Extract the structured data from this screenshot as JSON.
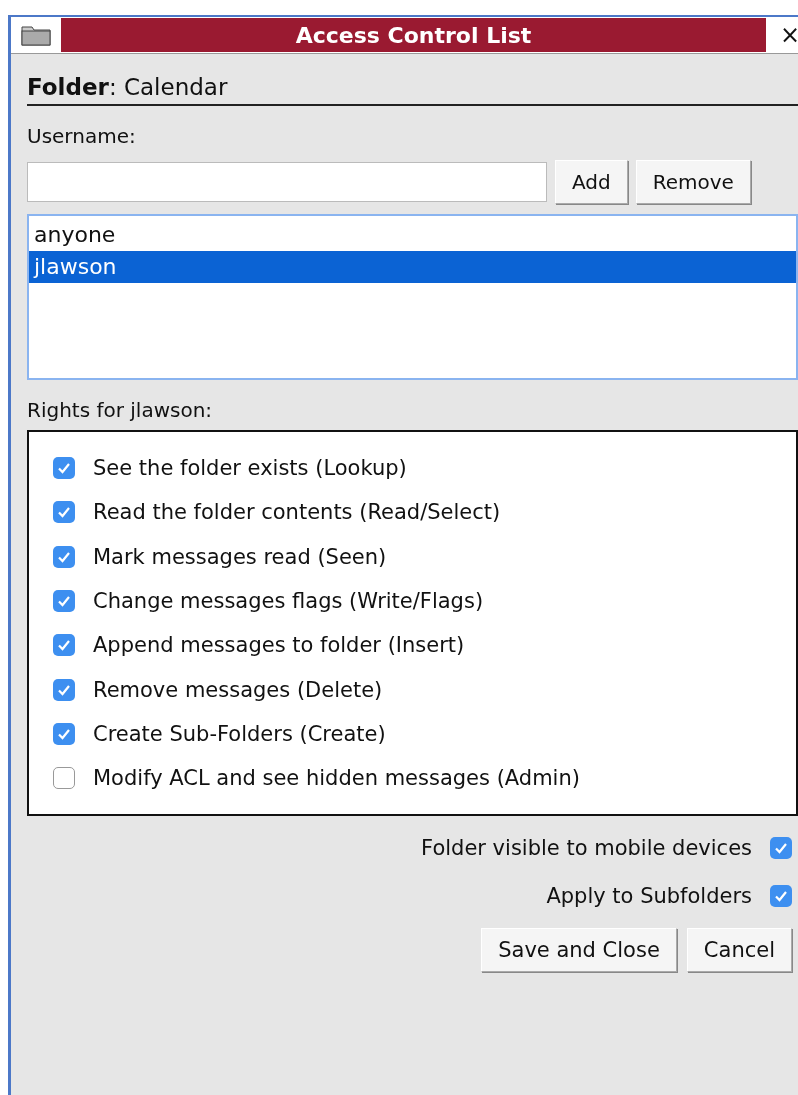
{
  "window": {
    "title": "Access Control List",
    "close": "×"
  },
  "folder": {
    "text": "**Folder**: Calendar"
  },
  "username": {
    "label": "Username:"
  },
  "buttons_top": [
    "Add",
    "Remove"
  ],
  "users": [
    {
      "name": "anyone",
      "selected": false
    },
    {
      "name": "jlawson",
      "selected": true
    }
  ],
  "rights": {
    "label": "Rights for jlawson:",
    "items": [
      {
        "label": "See the folder exists (Lookup)",
        "checked": true
      },
      {
        "label": "Read the folder contents (Read/Select)",
        "checked": true
      },
      {
        "label": "Mark messages read (Seen)",
        "checked": true
      },
      {
        "label": "Change messages flags (Write/Flags)",
        "checked": true
      },
      {
        "label": "Append messages to folder (Insert)",
        "checked": true
      },
      {
        "label": "Remove messages (Delete)",
        "checked": true
      },
      {
        "label": "Create Sub-Folders (Create)",
        "checked": true
      },
      {
        "label": "Modify ACL and see hidden messages (Admin)",
        "checked": false
      }
    ]
  },
  "options": [
    {
      "label": "Folder visible to mobile devices",
      "checked": true
    },
    {
      "label": "Apply to Subfolders",
      "checked": true
    }
  ],
  "buttons_bottom": [
    "Save and Close",
    "Cancel"
  ]
}
